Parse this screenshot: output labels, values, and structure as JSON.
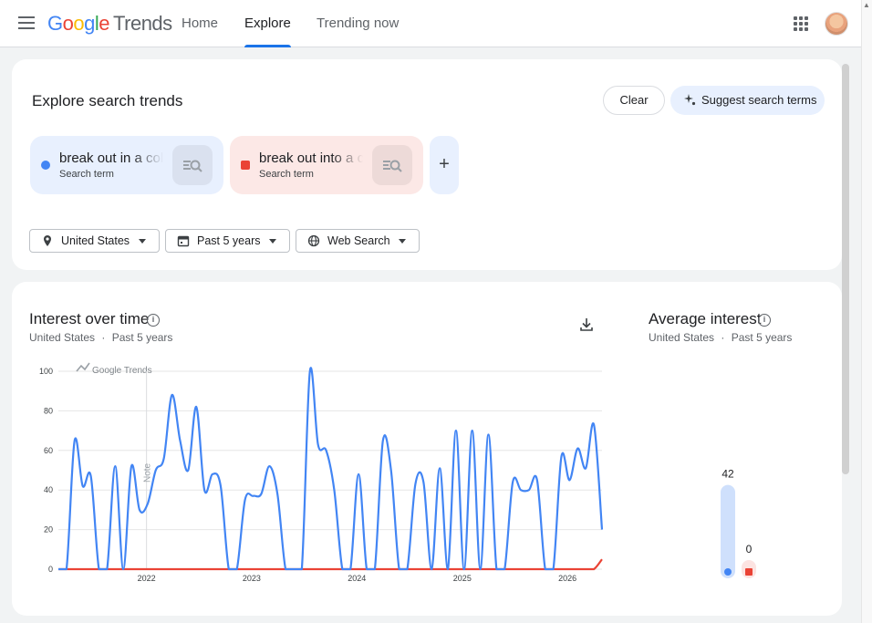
{
  "header": {
    "logo_google": "Google",
    "logo_trends": "Trends",
    "nav": [
      {
        "label": "Home",
        "active": false
      },
      {
        "label": "Explore",
        "active": true
      },
      {
        "label": "Trending now",
        "active": false
      }
    ]
  },
  "explore": {
    "title": "Explore search trends",
    "clear_label": "Clear",
    "suggest_label": "Suggest search terms",
    "terms": [
      {
        "name": "break out in a cold",
        "type": "Search term",
        "color": "#4285f4"
      },
      {
        "name": "break out into a co",
        "type": "Search term",
        "color": "#ea4335"
      }
    ],
    "filters": {
      "region": "United States",
      "time": "Past 5 years",
      "property": "Web Search"
    }
  },
  "interest": {
    "title": "Interest over time",
    "region": "United States",
    "time": "Past 5 years",
    "separator": "·",
    "watermark": "Google Trends",
    "note": "Note"
  },
  "average": {
    "title": "Average interest",
    "region": "United States",
    "time": "Past 5 years",
    "separator": "·"
  },
  "chart_data": [
    {
      "type": "line",
      "title": "Interest over time",
      "ylim": [
        0,
        100
      ],
      "yticks": [
        "0",
        "20",
        "40",
        "60",
        "80",
        "100"
      ],
      "xticks": [
        "2022",
        "2023",
        "2024",
        "2025",
        "2026"
      ],
      "x": [
        "2021-03",
        "2021-04",
        "2021-05",
        "2021-06",
        "2021-07",
        "2021-08",
        "2021-09",
        "2021-10",
        "2021-11",
        "2021-12",
        "2022-01",
        "2022-02",
        "2022-03",
        "2022-04",
        "2022-05",
        "2022-06",
        "2022-07",
        "2022-08",
        "2022-09",
        "2022-10",
        "2022-11",
        "2022-12",
        "2023-01",
        "2023-02",
        "2023-03",
        "2023-04",
        "2023-05",
        "2023-06",
        "2023-07",
        "2023-08",
        "2023-09",
        "2023-10",
        "2023-11",
        "2023-12",
        "2024-01",
        "2024-02",
        "2024-03",
        "2024-04",
        "2024-05",
        "2024-06",
        "2024-07",
        "2024-08",
        "2024-09",
        "2024-10",
        "2024-11",
        "2024-12",
        "2025-01",
        "2025-02",
        "2025-03",
        "2025-04",
        "2025-05",
        "2025-06",
        "2025-07",
        "2025-08",
        "2025-09",
        "2025-10",
        "2025-11",
        "2025-12",
        "2026-01",
        "2026-02",
        "2026-03",
        "2026-04",
        "2026-05"
      ],
      "series": [
        {
          "name": "break out in a cold",
          "color": "#4285f4",
          "values": [
            0,
            0,
            65,
            42,
            47,
            0,
            0,
            52,
            0,
            52,
            30,
            33,
            50,
            56,
            88,
            65,
            50,
            82,
            40,
            48,
            42,
            0,
            0,
            35,
            37,
            38,
            52,
            38,
            0,
            0,
            0,
            100,
            63,
            60,
            40,
            0,
            0,
            48,
            0,
            0,
            65,
            50,
            0,
            0,
            43,
            44,
            0,
            51,
            0,
            70,
            0,
            70,
            0,
            68,
            0,
            0,
            44,
            40,
            40,
            45,
            0,
            0,
            57,
            45,
            61,
            51,
            73,
            20
          ]
        },
        {
          "name": "break out into a co",
          "color": "#ea4335",
          "values": [
            0,
            0,
            0,
            0,
            0,
            0,
            0,
            0,
            0,
            0,
            0,
            0,
            0,
            0,
            0,
            0,
            0,
            0,
            0,
            0,
            0,
            0,
            0,
            0,
            0,
            0,
            0,
            0,
            0,
            0,
            0,
            0,
            0,
            0,
            0,
            0,
            0,
            0,
            0,
            0,
            0,
            0,
            0,
            0,
            0,
            0,
            0,
            0,
            0,
            0,
            0,
            0,
            0,
            0,
            0,
            0,
            0,
            0,
            0,
            0,
            0,
            0,
            0,
            0,
            0,
            0,
            0,
            5
          ]
        }
      ]
    },
    {
      "type": "bar",
      "title": "Average interest",
      "ylim": [
        0,
        100
      ],
      "categories": [
        "break out in a cold",
        "break out into a co"
      ],
      "values": [
        42,
        0
      ],
      "labels": [
        "42",
        "0"
      ],
      "colors": [
        "#4285f4",
        "#ea4335"
      ]
    }
  ]
}
